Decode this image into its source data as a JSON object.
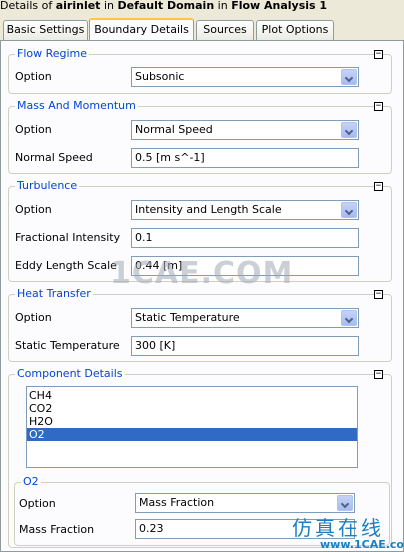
{
  "title": {
    "prefix": "Details of ",
    "object": "airinlet",
    "mid1": " in ",
    "domain": "Default Domain",
    "mid2": " in ",
    "analysis": "Flow Analysis 1"
  },
  "tabs": [
    "Basic Settings",
    "Boundary Details",
    "Sources",
    "Plot Options"
  ],
  "active_tab": "Boundary Details",
  "collapse_glyph": "−",
  "flow_regime": {
    "legend": "Flow Regime",
    "option_label": "Option",
    "option_value": "Subsonic"
  },
  "mass_momentum": {
    "legend": "Mass And Momentum",
    "option_label": "Option",
    "option_value": "Normal Speed",
    "speed_label": "Normal Speed",
    "speed_value": "0.5 [m s^-1]"
  },
  "turbulence": {
    "legend": "Turbulence",
    "option_label": "Option",
    "option_value": "Intensity and Length Scale",
    "intensity_label": "Fractional Intensity",
    "intensity_value": "0.1",
    "eddy_label": "Eddy Length Scale",
    "eddy_value": "0.44 [m]"
  },
  "heat_transfer": {
    "legend": "Heat Transfer",
    "option_label": "Option",
    "option_value": "Static Temperature",
    "temp_label": "Static Temperature",
    "temp_value": "300 [K]"
  },
  "component_details": {
    "legend": "Component Details",
    "items": [
      "CH4",
      "CO2",
      "H2O",
      "O2"
    ],
    "selected": "O2"
  },
  "o2": {
    "legend": "O2",
    "option_label": "Option",
    "option_value": "Mass Fraction",
    "fraction_label": "Mass Fraction",
    "fraction_value": "0.23"
  },
  "watermark": {
    "center": "1CAE.COM",
    "corner_cn": "仿真在线",
    "corner_url": "www.1CAE.com"
  },
  "colors": {
    "legend": "#0046d5",
    "selection": "#316ac5",
    "background": "#ece9d8",
    "panel": "#fcfcfe"
  }
}
